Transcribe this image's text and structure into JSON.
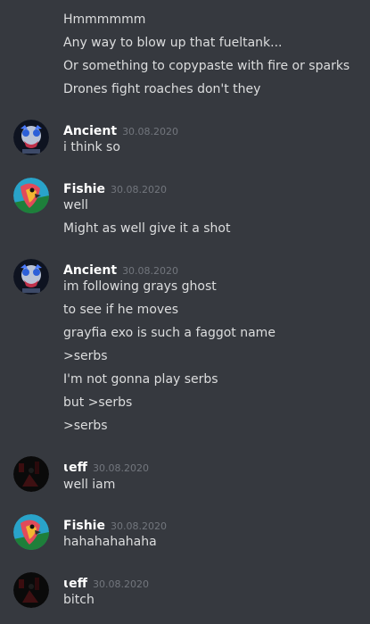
{
  "messages": {
    "continued": [
      "Hmmmmmm",
      "Any way to blow up that fueltank...",
      "Or something to copypaste with fire or sparks",
      "Drones fight roaches don't they"
    ],
    "groups": [
      {
        "author": "Ancient",
        "avatar": "robot-avatar-icon",
        "timestamp": "30.08.2020",
        "lines": [
          "i think so"
        ]
      },
      {
        "author": "Fishie",
        "avatar": "parrot-avatar-icon",
        "timestamp": "30.08.2020",
        "lines": [
          "well",
          "Might as well give it a shot"
        ]
      },
      {
        "author": "Ancient",
        "avatar": "robot-avatar-icon",
        "timestamp": "30.08.2020",
        "lines": [
          "im following grays ghost",
          "to see if he moves",
          "grayfia exo is such a faggot name",
          ">serbs",
          "I'm not gonna play serbs",
          "but >serbs",
          ">serbs"
        ]
      },
      {
        "author": "ɩeff",
        "avatar": "dark-avatar-icon",
        "timestamp": "30.08.2020",
        "lines": [
          "well iam"
        ]
      },
      {
        "author": "Fishie",
        "avatar": "parrot-avatar-icon",
        "timestamp": "30.08.2020",
        "lines": [
          "hahahahahaha"
        ]
      },
      {
        "author": "ɩeff",
        "avatar": "dark-avatar-icon",
        "timestamp": "30.08.2020",
        "lines": [
          "bitch"
        ]
      }
    ]
  },
  "colors": {
    "background": "#36393f",
    "author": "#ffffff",
    "text": "#dcddde",
    "timestamp": "#72767d"
  }
}
